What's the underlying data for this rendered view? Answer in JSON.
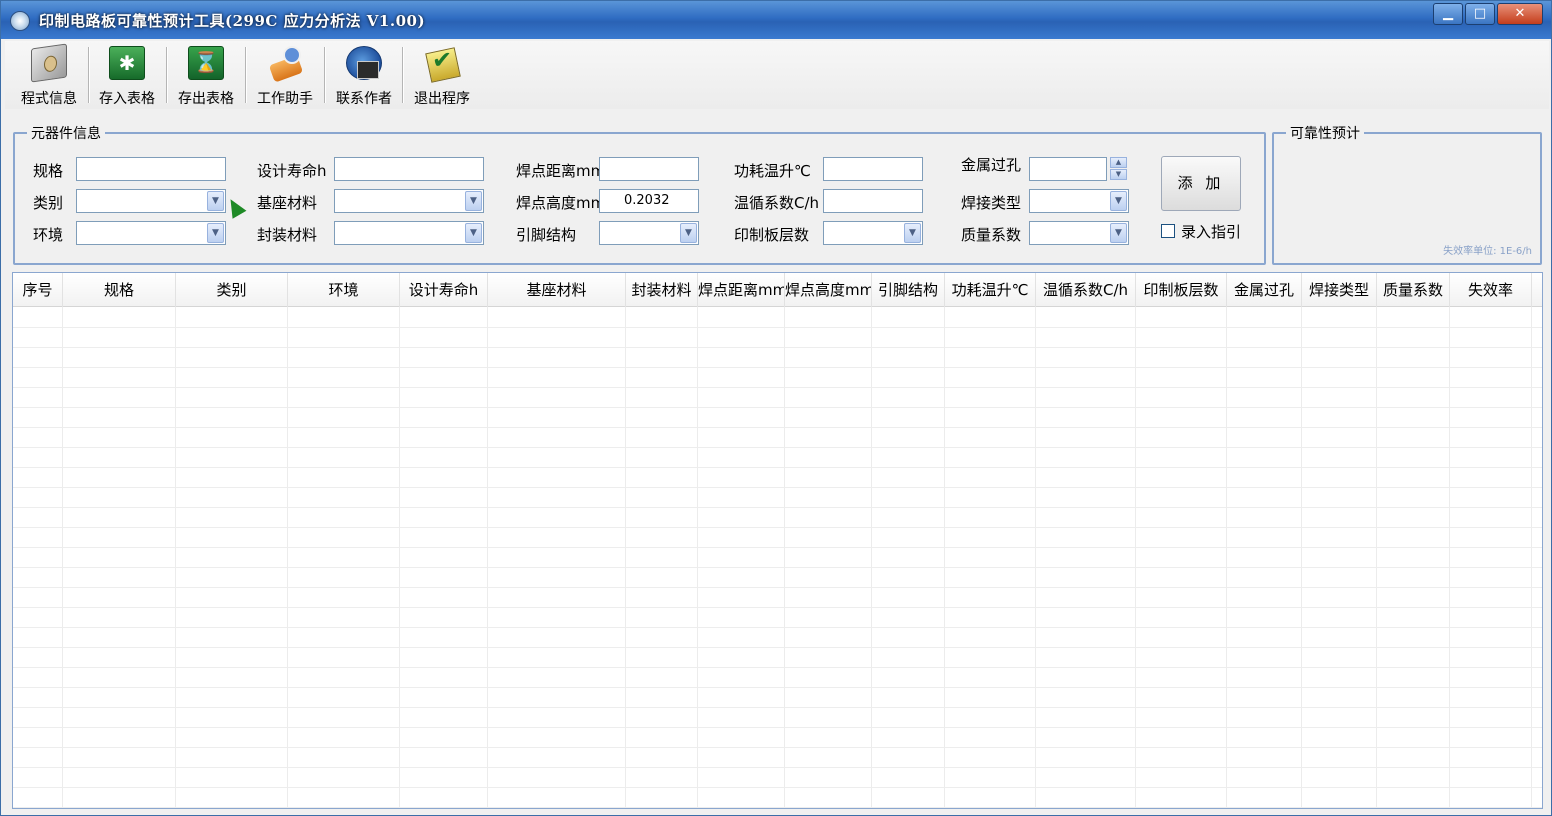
{
  "window": {
    "title": "印制电路板可靠性预计工具(299C 应力分析法  V1.00)",
    "minimize": "▁",
    "maximize": "□",
    "close": "✕"
  },
  "toolbar": {
    "items": [
      {
        "label": "程式信息",
        "icon": "program-info-icon"
      },
      {
        "label": "存入表格",
        "icon": "save-table-icon"
      },
      {
        "label": "存出表格",
        "icon": "export-table-icon"
      },
      {
        "label": "工作助手",
        "icon": "work-assistant-icon"
      },
      {
        "label": "联系作者",
        "icon": "contact-author-icon"
      },
      {
        "label": "退出程序",
        "icon": "exit-program-icon"
      }
    ]
  },
  "component_info": {
    "group_title": "元器件信息",
    "fields": {
      "spec": {
        "label": "规格",
        "value": ""
      },
      "category": {
        "label": "类别",
        "value": ""
      },
      "environment": {
        "label": "环境",
        "value": ""
      },
      "design_life": {
        "label": "设计寿命h",
        "value": ""
      },
      "base_material": {
        "label": "基座材料",
        "value": ""
      },
      "package_material": {
        "label": "封装材料",
        "value": ""
      },
      "joint_distance": {
        "label": "焊点距离mm",
        "value": ""
      },
      "joint_height": {
        "label": "焊点高度mm",
        "value": "0.2032"
      },
      "lead_structure": {
        "label": "引脚结构",
        "value": ""
      },
      "power_temp_rise": {
        "label": "功耗温升℃",
        "value": ""
      },
      "thermal_cycle": {
        "label": "温循系数C/h",
        "value": ""
      },
      "pcb_layers": {
        "label": "印制板层数",
        "value": ""
      },
      "metal_via": {
        "label": "金属过孔",
        "value": ""
      },
      "weld_type": {
        "label": "焊接类型",
        "value": ""
      },
      "quality_factor": {
        "label": "质量系数",
        "value": ""
      }
    },
    "add_button": "添 加",
    "guide_checkbox": {
      "label": "录入指引",
      "checked": false
    }
  },
  "reliability": {
    "group_title": "可靠性预计",
    "unit_note": "失效率单位: 1E-6/h"
  },
  "grid": {
    "columns": [
      "序号",
      "规格",
      "类别",
      "环境",
      "设计寿命h",
      "基座材料",
      "封装材料",
      "焊点距离mm",
      "焊点高度mm",
      "引脚结构",
      "功耗温升℃",
      "温循系数C/h",
      "印制板层数",
      "金属过孔",
      "焊接类型",
      "质量系数",
      "失效率"
    ],
    "rows": []
  },
  "colors": {
    "title_bar": "#2f6cc2",
    "group_border": "#8aa6cf",
    "input_border": "#7f9db9"
  }
}
